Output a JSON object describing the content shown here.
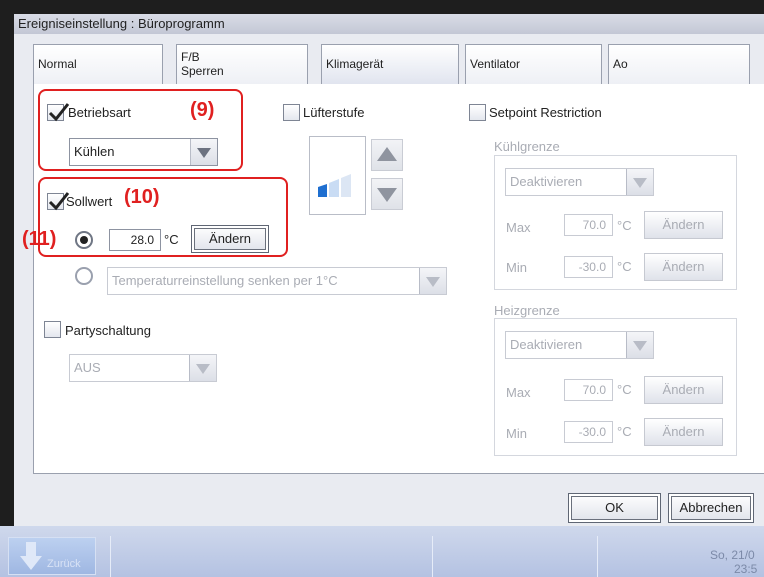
{
  "window": {
    "title": "Ereigniseinstellung : Büroprogramm"
  },
  "tabs": [
    {
      "label": "Normal"
    },
    {
      "label_line1": "F/B",
      "label_line2": "Sperren"
    },
    {
      "label": "Klimagerät",
      "active": true
    },
    {
      "label": "Ventilator"
    },
    {
      "label": "Ao"
    }
  ],
  "betriebsart": {
    "label": "Betriebsart",
    "checked": true,
    "value": "Kühlen",
    "marker": "(9)"
  },
  "luefterstufe": {
    "label": "Lüfterstufe",
    "checked": false
  },
  "sollwert": {
    "label": "Sollwert",
    "checked": true,
    "marker": "(10)",
    "marker_radio": "(11)",
    "value": "28.0",
    "unit": "°C",
    "change_label": "Ändern",
    "alt_option": "Temperaturreinstellung senken per 1°C"
  },
  "party": {
    "label": "Partyschaltung",
    "checked": false,
    "value": "AUS"
  },
  "setpoint": {
    "label": "Setpoint Restriction",
    "checked": false,
    "cool": {
      "title": "Kühlgrenze",
      "mode": "Deaktivieren",
      "max_label": "Max",
      "max_value": "70.0",
      "min_label": "Min",
      "min_value": "-30.0",
      "unit": "°C",
      "change_label": "Ändern"
    },
    "heat": {
      "title": "Heizgrenze",
      "mode": "Deaktivieren",
      "max_label": "Max",
      "max_value": "70.0",
      "min_label": "Min",
      "min_value": "-30.0",
      "unit": "°C",
      "change_label": "Ändern"
    }
  },
  "footer": {
    "ok_label": "OK",
    "cancel_label": "Abbrechen"
  },
  "taskbar": {
    "back_label": "Zurück",
    "date": "So, 21/0",
    "time": "23:5"
  },
  "colors": {
    "accent_red": "#e02020",
    "fan_blue": "#1f6fd0"
  }
}
